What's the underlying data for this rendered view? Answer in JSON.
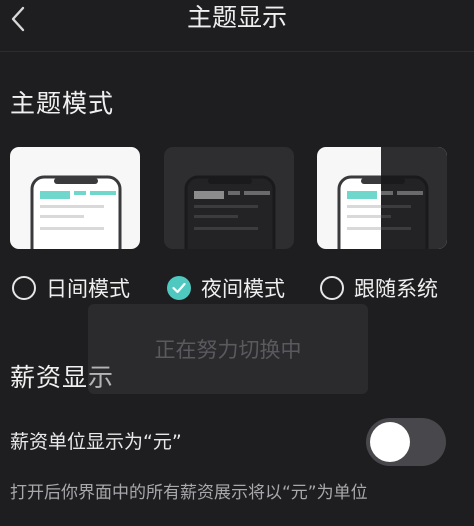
{
  "nav": {
    "title": "主题显示",
    "back_icon": "chevron-left-icon"
  },
  "theme_section": {
    "title": "主题模式",
    "options": [
      {
        "label": "日间模式",
        "selected": false,
        "preview": "light"
      },
      {
        "label": "夜间模式",
        "selected": true,
        "preview": "dark"
      },
      {
        "label": "跟随系统",
        "selected": false,
        "preview": "split"
      }
    ]
  },
  "toast": {
    "text": "正在努力切换中"
  },
  "salary_section": {
    "title": "薪资显示",
    "setting_label": "薪资单位显示为“元”",
    "toggle_on": false,
    "description": "打开后你界面中的所有薪资展示将以“元”为单位"
  },
  "colors": {
    "background": "#1e1e20",
    "accent": "#4fc9c0",
    "toggle_off": "#48484c"
  }
}
